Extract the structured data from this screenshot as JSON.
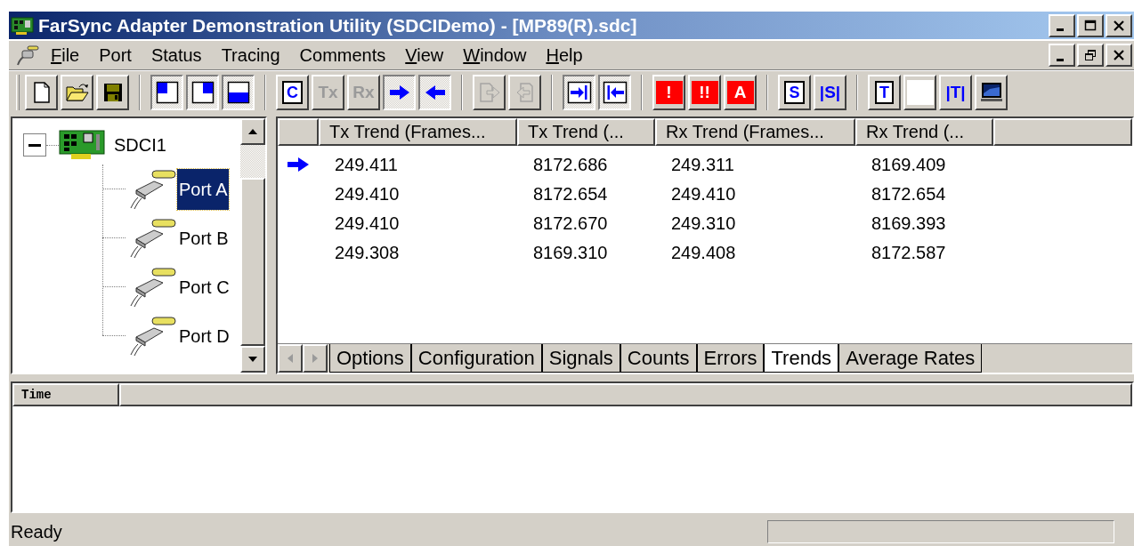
{
  "window": {
    "title": "FarSync Adapter Demonstration Utility (SDCIDemo) - [MP89(R).sdc]"
  },
  "menu": [
    {
      "label": "File",
      "underlined_initial": true
    },
    {
      "label": "Port",
      "underlined_initial": false
    },
    {
      "label": "Status",
      "underlined_initial": false
    },
    {
      "label": "Tracing",
      "underlined_initial": false
    },
    {
      "label": "Comments",
      "underlined_initial": false
    },
    {
      "label": "View",
      "underlined_initial": true
    },
    {
      "label": "Window",
      "underlined_initial": true
    },
    {
      "label": "Help",
      "underlined_initial": true
    }
  ],
  "toolbar": [
    [
      {
        "kind": "new",
        "pressed": false,
        "disabled": false
      },
      {
        "kind": "open",
        "pressed": false,
        "disabled": false
      },
      {
        "kind": "save",
        "pressed": false,
        "disabled": false
      }
    ],
    [
      {
        "kind": "layout_tl",
        "pressed": true,
        "disabled": false
      },
      {
        "kind": "layout_tr",
        "pressed": true,
        "disabled": false
      },
      {
        "kind": "layout_bottom",
        "pressed": true,
        "disabled": false
      }
    ],
    [
      {
        "kind": "boxed_letter",
        "label": "C",
        "pressed": false,
        "disabled": false
      },
      {
        "kind": "plain_letter",
        "label": "Tx",
        "pressed": false,
        "disabled": true
      },
      {
        "kind": "plain_letter",
        "label": "Rx",
        "pressed": false,
        "disabled": true
      },
      {
        "kind": "arrow_right",
        "pressed": true,
        "disabled": false
      },
      {
        "kind": "arrow_left",
        "pressed": true,
        "disabled": false
      }
    ],
    [
      {
        "kind": "export",
        "pressed": false,
        "disabled": true
      },
      {
        "kind": "import",
        "pressed": false,
        "disabled": true
      }
    ],
    [
      {
        "kind": "goto_end",
        "pressed": true,
        "disabled": false
      },
      {
        "kind": "goto_start",
        "pressed": true,
        "disabled": false
      }
    ],
    [
      {
        "kind": "red_letter",
        "label": "!",
        "pressed": false,
        "disabled": false
      },
      {
        "kind": "red_letter",
        "label": "!!",
        "pressed": false,
        "disabled": false
      },
      {
        "kind": "red_letter",
        "label": "A",
        "pressed": false,
        "disabled": false
      }
    ],
    [
      {
        "kind": "boxed_letter",
        "label": "S",
        "pressed": false,
        "disabled": false
      },
      {
        "kind": "plain_letter",
        "label": "|S|",
        "pressed": false,
        "disabled": false
      }
    ],
    [
      {
        "kind": "boxed_letter",
        "label": "T",
        "pressed": false,
        "disabled": false
      },
      {
        "kind": "blank",
        "pressed": false
      },
      {
        "kind": "plain_letter",
        "label": "|T|",
        "pressed": false,
        "disabled": false
      },
      {
        "kind": "monitor",
        "pressed": false,
        "disabled": false
      }
    ]
  ],
  "tree": [
    {
      "label": "SDCI1",
      "expanded": true,
      "selected": false,
      "children": [
        {
          "label": "Port A",
          "selected": true
        },
        {
          "label": "Port B",
          "selected": false
        },
        {
          "label": "Port C",
          "selected": false
        },
        {
          "label": "Port D",
          "selected": false
        }
      ]
    }
  ],
  "table": {
    "columns": [
      "Tx Trend (Frames...",
      "Tx Trend (...",
      "Rx Trend (Frames...",
      "Rx Trend (..."
    ],
    "rows": [
      {
        "current": true,
        "cells": [
          "249.411",
          "8172.686",
          "249.311",
          "8169.409"
        ]
      },
      {
        "current": false,
        "cells": [
          "249.410",
          "8172.654",
          "249.410",
          "8172.654"
        ]
      },
      {
        "current": false,
        "cells": [
          "249.410",
          "8172.670",
          "249.310",
          "8169.393"
        ]
      },
      {
        "current": false,
        "cells": [
          "249.308",
          "8169.310",
          "249.408",
          "8172.587"
        ]
      }
    ]
  },
  "tabs": [
    {
      "label": "Options",
      "selected": false
    },
    {
      "label": "Configuration",
      "selected": false
    },
    {
      "label": "Signals",
      "selected": false
    },
    {
      "label": "Counts",
      "selected": false
    },
    {
      "label": "Errors",
      "selected": false
    },
    {
      "label": "Trends",
      "selected": true
    },
    {
      "label": "Average Rates",
      "selected": false
    }
  ],
  "log": {
    "columns": [
      "Time"
    ]
  },
  "status_bar": {
    "text": "Ready"
  }
}
